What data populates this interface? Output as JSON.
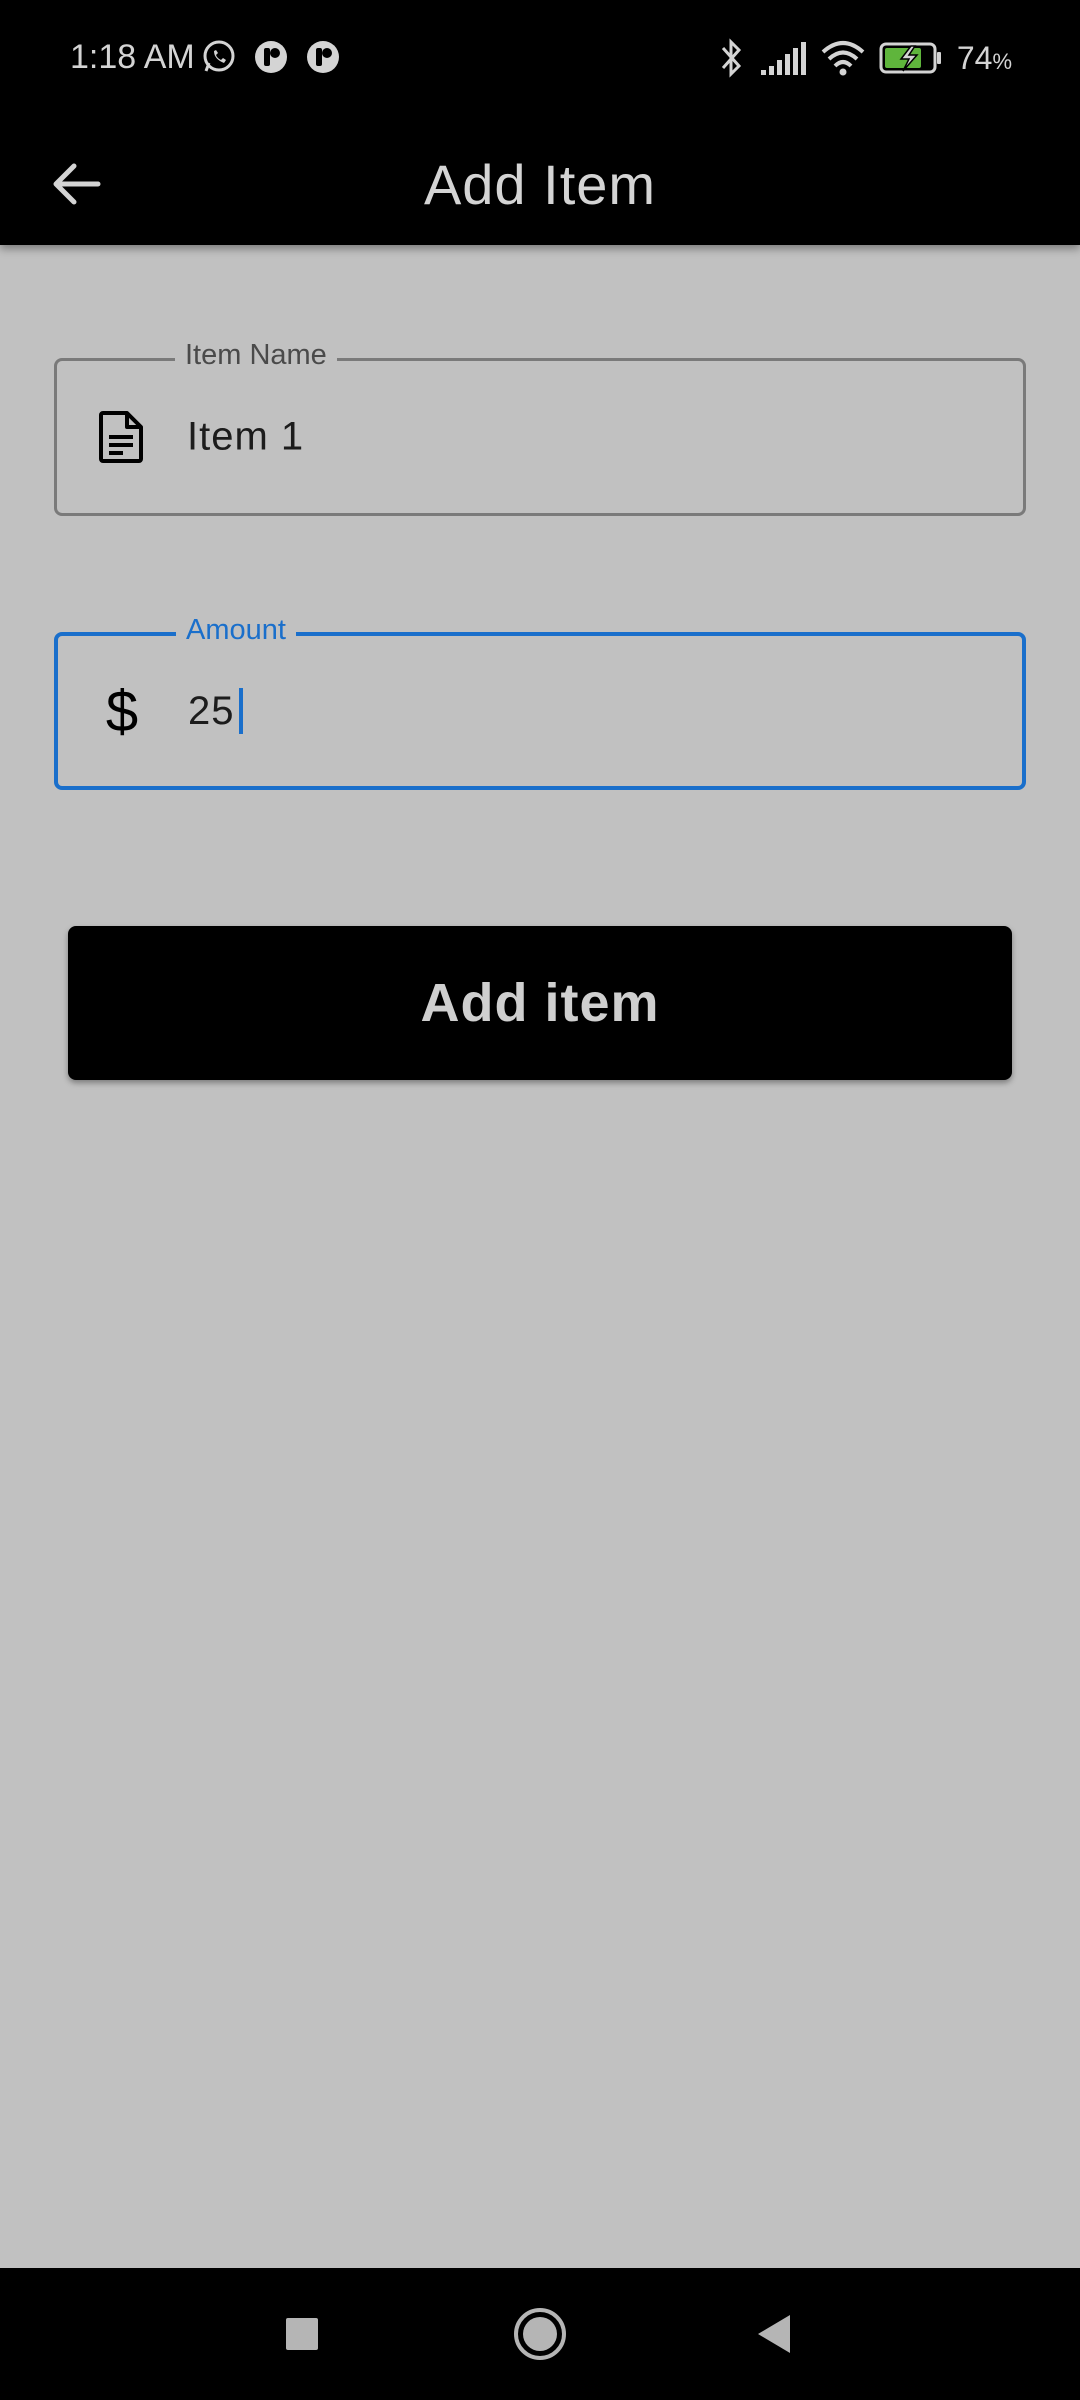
{
  "status_bar": {
    "time": "1:18 AM",
    "battery_percent": "74",
    "battery_unit": "%",
    "icons": [
      "whatsapp-icon",
      "app-notification-icon",
      "app-notification-icon",
      "bluetooth-icon",
      "signal-icon",
      "wifi-icon",
      "battery-charging-icon"
    ]
  },
  "app_bar": {
    "title": "Add Item",
    "back_icon": "arrow-left-icon"
  },
  "form": {
    "item_name": {
      "label": "Item Name",
      "value": "Item 1",
      "icon": "document-icon"
    },
    "amount": {
      "label": "Amount",
      "value": "25",
      "prefix": "$",
      "focused": true
    },
    "submit_label": "Add item"
  },
  "colors": {
    "background": "#c1c1c1",
    "app_bar": "#000000",
    "focus_accent": "#1a6fcb",
    "button": "#000000",
    "button_text": "#cfcfcf"
  },
  "nav_bar": {
    "icons": [
      "recents-square-icon",
      "home-circle-icon",
      "back-triangle-icon"
    ]
  }
}
